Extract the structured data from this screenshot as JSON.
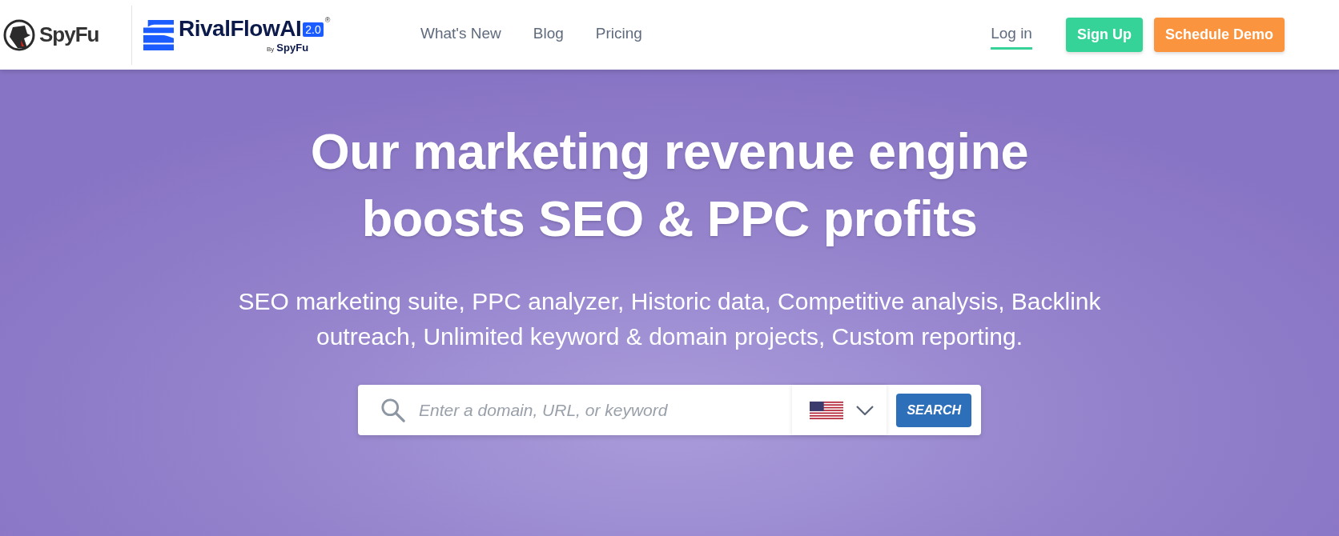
{
  "header": {
    "logo": {
      "name": "SpyFu"
    },
    "product_logo": {
      "name": "RivalFlowAI",
      "version": "2.0",
      "mark": "®",
      "byline_prefix": "By",
      "byline_brand": "SpyFu"
    },
    "nav": [
      {
        "label": "What's New",
        "selected": false
      },
      {
        "label": "Blog",
        "selected": false
      },
      {
        "label": "Pricing",
        "selected": false
      }
    ],
    "login": {
      "label": "Log in",
      "selected": true
    },
    "buttons": [
      {
        "label": "Sign Up",
        "kind": "signup"
      },
      {
        "label": "Schedule Demo",
        "kind": "demo"
      }
    ]
  },
  "hero": {
    "headline": "Our marketing revenue engine boosts SEO & PPC profits",
    "subtitle": "SEO marketing suite, PPC analyzer, Historic data, Competitive analysis, Backlink outreach, Unlimited keyword & domain projects, Custom reporting.",
    "search": {
      "placeholder": "Enter a domain, URL, or keyword",
      "button": "SEARCH"
    }
  }
}
